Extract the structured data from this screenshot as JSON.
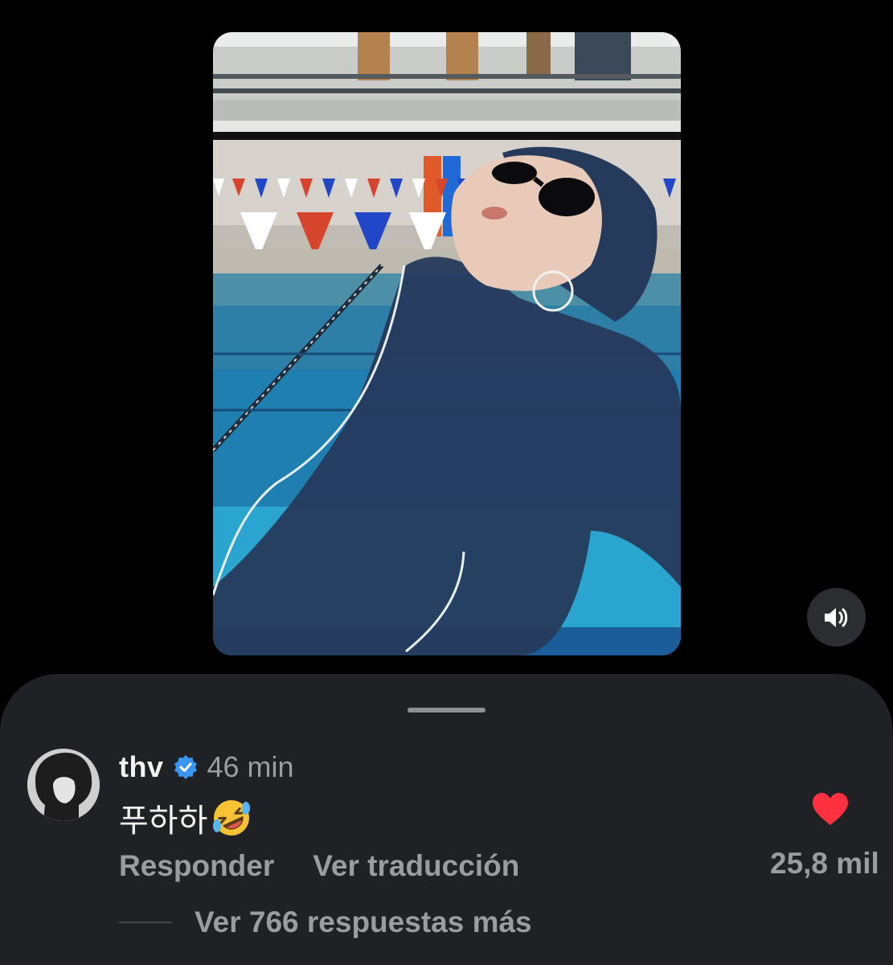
{
  "comment": {
    "username": "thv",
    "time": "46 min",
    "text": "푸하하",
    "emoji": "rolling-on-floor-laughing-emoji",
    "reply_label": "Responder",
    "translate_label": "Ver traducción",
    "like_count": "25,8 mil",
    "more_replies_label": "Ver 766 respuestas más"
  },
  "colors": {
    "background": "#000000",
    "sheet": "#1f2125",
    "primary_text": "#f2f2f2",
    "secondary_text": "#9a9ca2",
    "like_heart": "#ff3040",
    "verified_badge": "#3897f0"
  },
  "icons": {
    "sound": "speaker-icon",
    "verified": "verified-badge-icon",
    "like": "heart-icon",
    "avatar": "avatar"
  }
}
